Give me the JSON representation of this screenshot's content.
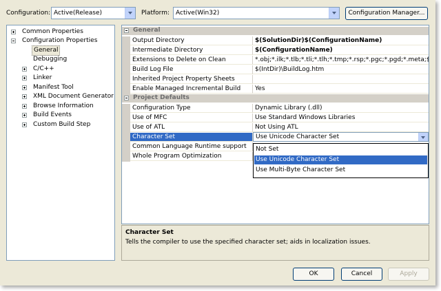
{
  "toolbar": {
    "configuration_label": "Configuration:",
    "configuration_value": "Active(Release)",
    "platform_label": "Platform:",
    "platform_value": "Active(Win32)",
    "config_manager_button": "Configuration Manager..."
  },
  "tree": {
    "items": [
      {
        "label": "Common Properties",
        "expander": "plus"
      },
      {
        "label": "Configuration Properties",
        "expander": "minus"
      },
      {
        "label": "General",
        "expander": "none",
        "selected": true
      },
      {
        "label": "Debugging",
        "expander": "none"
      },
      {
        "label": "C/C++",
        "expander": "plus"
      },
      {
        "label": "Linker",
        "expander": "plus"
      },
      {
        "label": "Manifest Tool",
        "expander": "plus"
      },
      {
        "label": "XML Document Generator",
        "expander": "plus"
      },
      {
        "label": "Browse Information",
        "expander": "plus"
      },
      {
        "label": "Build Events",
        "expander": "plus"
      },
      {
        "label": "Custom Build Step",
        "expander": "plus"
      }
    ]
  },
  "grid": {
    "sections": [
      {
        "title": "General",
        "rows": [
          {
            "name": "Output Directory",
            "value": "$(SolutionDir)$(ConfigurationName)",
            "bold": true
          },
          {
            "name": "Intermediate Directory",
            "value": "$(ConfigurationName)",
            "bold": true
          },
          {
            "name": "Extensions to Delete on Clean",
            "value": "*.obj;*.ilk;*.tlb;*.tli;*.tlh;*.tmp;*.rsp;*.pgc;*.pgd;*.meta;$(",
            "bold": false
          },
          {
            "name": "Build Log File",
            "value": "$(IntDir)\\BuildLog.htm",
            "bold": false
          },
          {
            "name": "Inherited Project Property Sheets",
            "value": "",
            "bold": false
          },
          {
            "name": "Enable Managed Incremental Build",
            "value": "Yes",
            "bold": false
          }
        ]
      },
      {
        "title": "Project Defaults",
        "rows": [
          {
            "name": "Configuration Type",
            "value": "Dynamic Library (.dll)",
            "bold": false
          },
          {
            "name": "Use of MFC",
            "value": "Use Standard Windows Libraries",
            "bold": false
          },
          {
            "name": "Use of ATL",
            "value": "Not Using ATL",
            "bold": false
          },
          {
            "name": "Character Set",
            "value": "Use Unicode Character Set",
            "bold": false,
            "selected": true
          },
          {
            "name": "Common Language Runtime support",
            "value": "",
            "bold": false
          },
          {
            "name": "Whole Program Optimization",
            "value": "",
            "bold": false
          }
        ]
      }
    ],
    "dropdown_options": [
      "Not Set",
      "Use Unicode Character Set",
      "Use Multi-Byte Character Set"
    ],
    "dropdown_highlighted": "Use Unicode Character Set"
  },
  "description": {
    "title": "Character Set",
    "text": "Tells the compiler to use the specified character set; aids in localization issues."
  },
  "footer": {
    "ok": "OK",
    "cancel": "Cancel",
    "apply": "Apply"
  },
  "colors": {
    "selection": "#316ac5",
    "dialog_bg": "#ece9d8",
    "category_bg": "#d4d0c8"
  }
}
